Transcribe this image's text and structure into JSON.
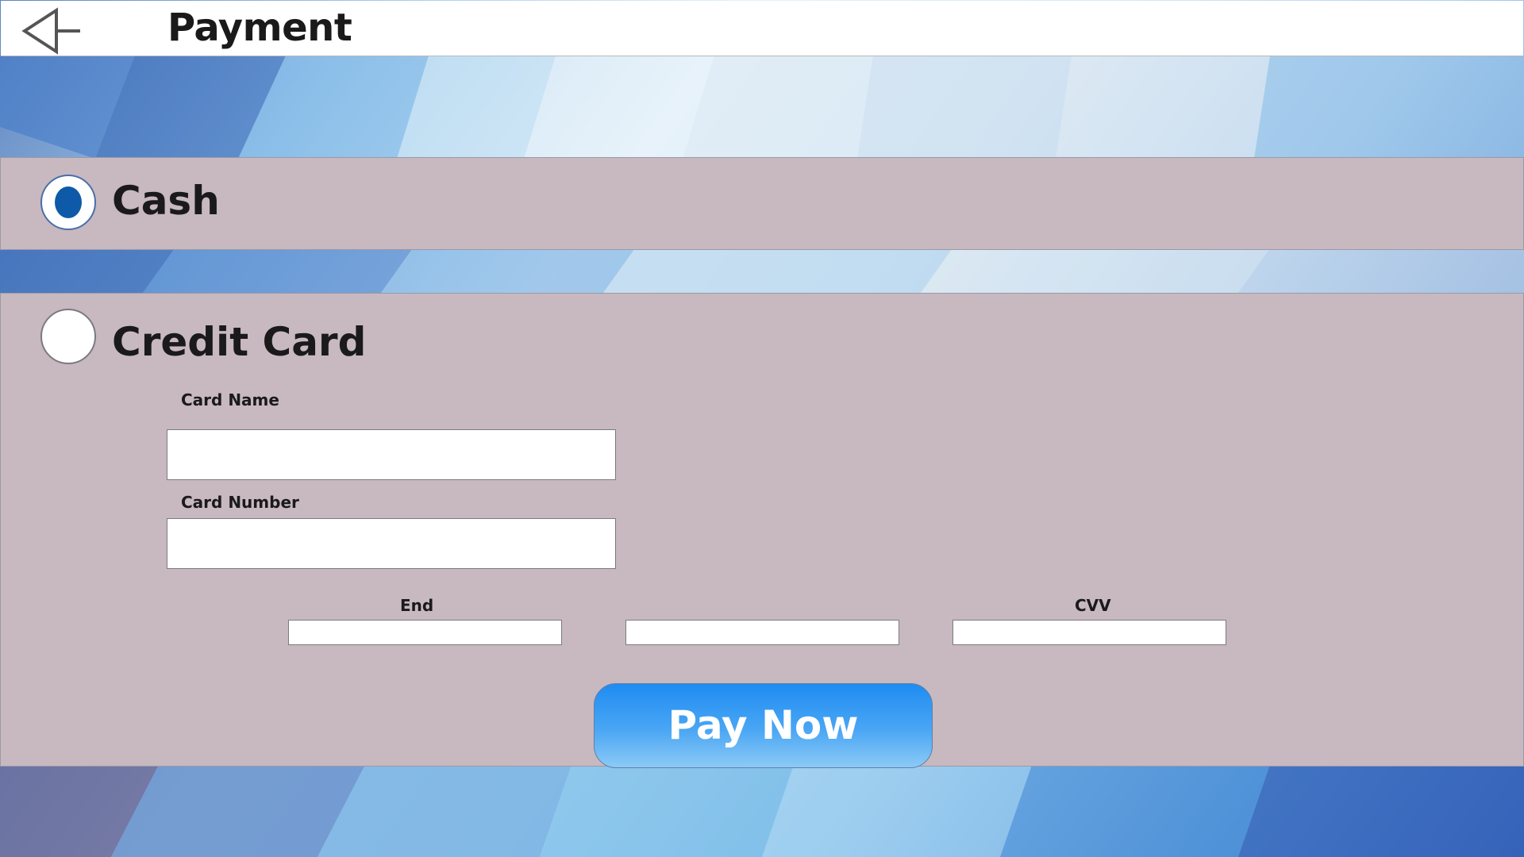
{
  "header": {
    "title": "Payment",
    "back_icon": "back-arrow-icon"
  },
  "payment_options": {
    "cash": {
      "label": "Cash",
      "selected": true
    },
    "credit_card": {
      "label": "Credit Card",
      "selected": false
    }
  },
  "form": {
    "card_name": {
      "label": "Card Name",
      "value": ""
    },
    "card_number": {
      "label": "Card Number",
      "value": ""
    },
    "end": {
      "label": "End",
      "month_value": "",
      "year_value": ""
    },
    "cvv": {
      "label": "CVV",
      "value": ""
    }
  },
  "pay_button": {
    "label": "Pay Now"
  },
  "colors": {
    "panel_bg": "#c8b8c0",
    "radio_selected": "#0f5aa8",
    "button_top": "#1f8cf2",
    "button_bottom": "#8ccaf6"
  }
}
